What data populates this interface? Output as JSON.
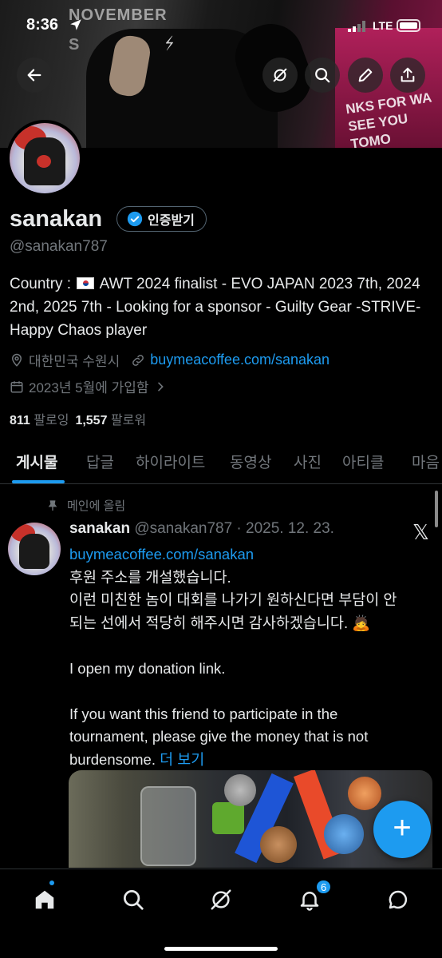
{
  "status_bar": {
    "time": "8:36",
    "network": "LTE"
  },
  "banner": {
    "text_line1": "NOVEMBER",
    "text_line2": "S",
    "pink_text": "NKS FOR WA SEE YOU TOMO"
  },
  "profile": {
    "name": "sanakan",
    "verify_label": "인증받기",
    "handle": "@sanakan787",
    "bio_before_flag": "Country : ",
    "bio_after_flag": " AWT 2024 finalist - EVO JAPAN 2023 7th, 2024 2nd, 2025 7th - Looking for a sponsor - Guilty Gear -STRIVE- Happy Chaos player",
    "location": "대한민국 수원시",
    "link": "buymeacoffee.com/sanakan",
    "joined": "2023년 5월에 가입함",
    "following_count": "811",
    "following_label": "팔로잉",
    "followers_count": "1,557",
    "followers_label": "팔로워"
  },
  "tabs": [
    "게시물",
    "답글",
    "하이라이트",
    "동영상",
    "사진",
    "아티클",
    "마음"
  ],
  "post": {
    "pinned_label": "메인에 올림",
    "author": "sanakan",
    "handle_date": "@sanakan787 · 2025. 12. 23.",
    "link": "buymeacoffee.com/sanakan",
    "line1": "후원 주소를 개설했습니다.",
    "line2": "이런 미친한 놈이 대회를 나가기 원하신다면 부담이 안",
    "line3": "되는 선에서 적당히 해주시면 감사하겠습니다. 🙇",
    "line4": "I open my donation link.",
    "line5": "If you want this friend to participate in the",
    "line6": "tournament, please give the money that is not",
    "line7": "burdensome.",
    "more": "더 보기"
  },
  "fab_label": "+",
  "nav": {
    "notifications_badge": "6"
  },
  "colors": {
    "accent": "#1d9bf0",
    "background": "#000000",
    "muted": "#71767b"
  }
}
